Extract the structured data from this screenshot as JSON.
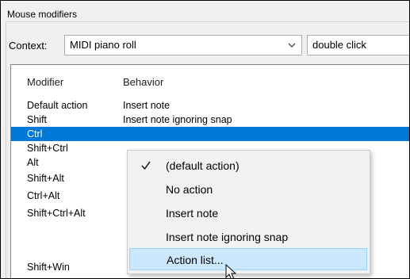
{
  "group_title": "Mouse modifiers",
  "context": {
    "label": "Context:",
    "selected": "MIDI piano roll",
    "action_selected": "double click"
  },
  "list": {
    "headers": {
      "modifier": "Modifier",
      "behavior": "Behavior"
    },
    "rows": [
      {
        "modifier": "Default action",
        "behavior": "Insert note"
      },
      {
        "modifier": "Shift",
        "behavior": "Insert note ignoring snap"
      },
      {
        "modifier": "Ctrl",
        "behavior": ""
      },
      {
        "modifier": "Shift+Ctrl",
        "behavior": ""
      },
      {
        "modifier": "Alt",
        "behavior": ""
      },
      {
        "modifier": "Shift+Alt",
        "behavior": ""
      },
      {
        "modifier": "Ctrl+Alt",
        "behavior": ""
      },
      {
        "modifier": "Shift+Ctrl+Alt",
        "behavior": ""
      },
      {
        "modifier": "Shift+Win",
        "behavior": ""
      }
    ],
    "selected_row": "Ctrl"
  },
  "context_menu": {
    "items": [
      {
        "label": "(default action)",
        "checked": true
      },
      {
        "label": "No action",
        "checked": false
      },
      {
        "label": "Insert note",
        "checked": false
      },
      {
        "label": "Insert note ignoring snap",
        "checked": false
      },
      {
        "label": "Action list...",
        "checked": false
      }
    ],
    "highlighted": "Action list..."
  },
  "icons": {
    "dropdown": "chevron-down-icon",
    "check": "check-icon",
    "cursor": "mouse-pointer-icon"
  },
  "colors": {
    "selection": "#0078d7",
    "menu_hover": "#cce8ff"
  }
}
